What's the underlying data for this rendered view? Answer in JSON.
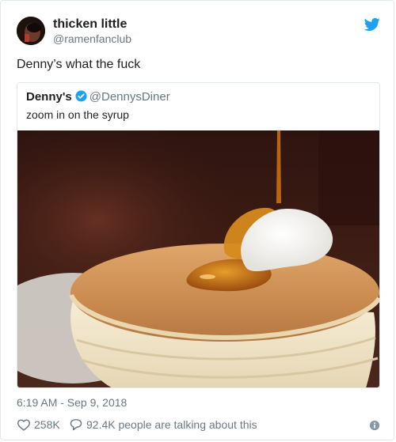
{
  "tweet": {
    "author_name": "thicken little",
    "author_handle": "@ramenfanclub",
    "text": "Denny’s what the fuck",
    "timestamp": "6:19 AM - Sep 9, 2018",
    "likes": "258K",
    "replies_label": "92.4K people are talking about this"
  },
  "quoted": {
    "author_name": "Denny's",
    "author_handle": "@DennysDiner",
    "verified": true,
    "text": "zoom in on the syrup"
  },
  "icons": {
    "brand": "twitter-bird-icon",
    "verified": "verified-badge-icon",
    "like": "heart-icon",
    "reply": "speech-bubble-icon",
    "info": "info-icon"
  },
  "colors": {
    "accent": "#1da1f2",
    "muted": "#697882",
    "text": "#1c2022",
    "border": "#e1e8ed"
  }
}
